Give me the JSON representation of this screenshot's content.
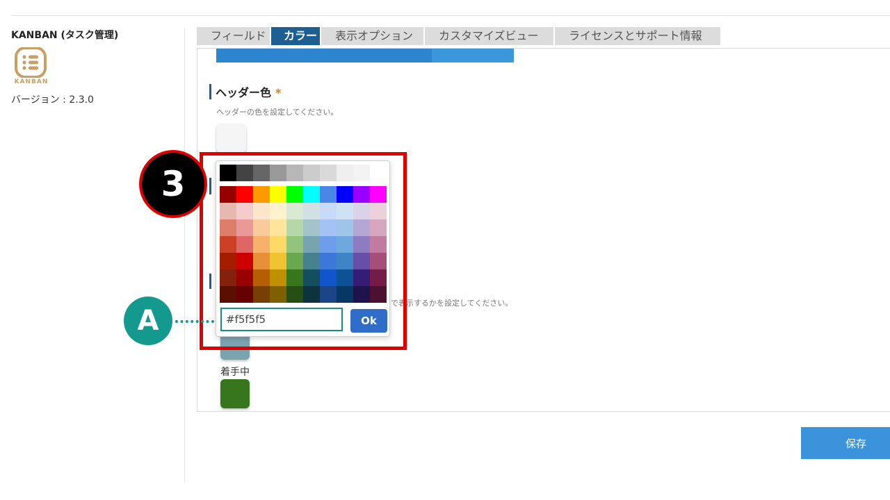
{
  "app": {
    "name": "KANBAN (タスク管理)",
    "logo_text": "KANBAN",
    "version": "バージョン : 2.3.0"
  },
  "tabs": [
    {
      "label": "フィールド",
      "active": false
    },
    {
      "label": "カラー",
      "active": true
    },
    {
      "label": "表示オプション",
      "active": false
    },
    {
      "label": "カスタマイズビュー",
      "active": false
    },
    {
      "label": "ライセンスとサポート情報",
      "active": false
    }
  ],
  "header_color": {
    "title": "ヘッダー色",
    "required_mark": "*",
    "description": "ヘッダーの色を設定してください。",
    "current_color": "#f5f5f5"
  },
  "status_colors": {
    "description_visible_part": "で表示するかを設定してください。",
    "items": [
      {
        "label": "",
        "color": "#7aa3b0"
      },
      {
        "label": "着手中",
        "color": "#38761d"
      }
    ]
  },
  "color_picker": {
    "grays": [
      "#000000",
      "#434343",
      "#666666",
      "#999999",
      "#b7b7b7",
      "#cccccc",
      "#d9d9d9",
      "#efefef",
      "#f3f3f3",
      "#ffffff"
    ],
    "rows": [
      [
        "#980000",
        "#ff0000",
        "#ff9900",
        "#ffff00",
        "#00ff00",
        "#00ffff",
        "#4a86e8",
        "#0000ff",
        "#9900ff",
        "#ff00ff"
      ],
      [
        "#e6b8af",
        "#f4cccc",
        "#fce5cd",
        "#fff2cc",
        "#d9ead3",
        "#d0e0e3",
        "#c9daf8",
        "#cfe2f3",
        "#d9d2e9",
        "#ead1dc"
      ],
      [
        "#dd7e6b",
        "#ea9999",
        "#f9cb9c",
        "#ffe599",
        "#b6d7a8",
        "#a2c4c9",
        "#a4c2f4",
        "#9fc5e8",
        "#b4a7d6",
        "#d5a6bd"
      ],
      [
        "#cc4125",
        "#e06666",
        "#f6b26b",
        "#ffd966",
        "#93c47d",
        "#76a5af",
        "#6d9eeb",
        "#6fa8dc",
        "#8e7cc3",
        "#c27ba0"
      ],
      [
        "#a61c00",
        "#cc0000",
        "#e69138",
        "#f1c232",
        "#6aa84f",
        "#45818e",
        "#3c78d8",
        "#3d85c6",
        "#674ea7",
        "#a64d79"
      ],
      [
        "#85200c",
        "#990000",
        "#b45f06",
        "#bf9000",
        "#38761d",
        "#134f5c",
        "#1155cc",
        "#0b5394",
        "#351c75",
        "#741b47"
      ],
      [
        "#5b0f00",
        "#660000",
        "#783f04",
        "#7f6000",
        "#274e13",
        "#0c343d",
        "#1c4587",
        "#073763",
        "#20124d",
        "#4c1130"
      ]
    ],
    "input_value": "#f5f5f5",
    "ok_label": "Ok"
  },
  "annotations": {
    "step_number": "3",
    "callout_letter": "A"
  },
  "save_label": "保存"
}
